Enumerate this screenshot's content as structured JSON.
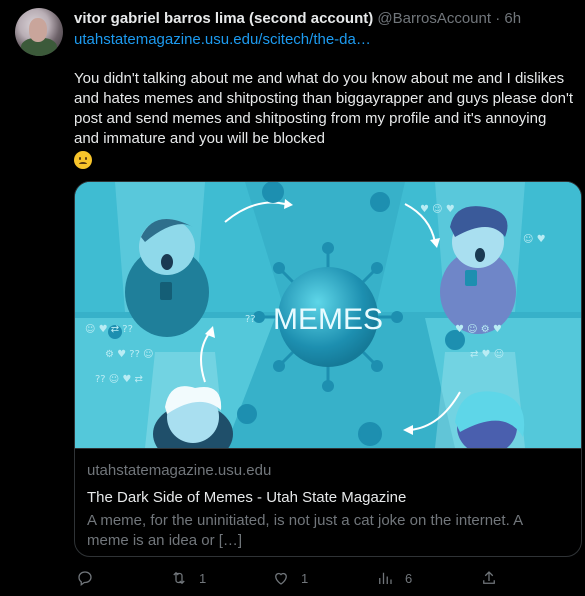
{
  "author": {
    "display_name": "vitor gabriel barros lima (second account)",
    "handle": "@BarrosAccount",
    "separator": "·",
    "time": "6h"
  },
  "tweet": {
    "link_text": "utahstatemagazine.usu.edu/scitech/the-da…",
    "body": "You didn't talking about me and what do you know about me and I dislikes and hates memes and shitposting than biggayrapper and guys please don't post and send memes and shitposting from my profile and it's annoying and immature and you will be blocked",
    "emoji": "frowning-face-emoji"
  },
  "card": {
    "image_text": "MEMES",
    "domain": "utahstatemagazine.usu.edu",
    "title": "The Dark Side of Memes - Utah State Magazine",
    "description": "A meme, for the uninitiated, is not just a cat joke on the internet. A meme is an idea or […]"
  },
  "actions": {
    "reply": {
      "icon": "reply-icon",
      "count": ""
    },
    "retweet": {
      "icon": "retweet-icon",
      "count": "1"
    },
    "like": {
      "icon": "heart-icon",
      "count": "1"
    },
    "views": {
      "icon": "views-icon",
      "count": "6"
    },
    "share": {
      "icon": "share-icon",
      "count": ""
    }
  },
  "colors": {
    "background": "#000000",
    "link": "#1d9bf0",
    "muted": "#71767b",
    "card_teal": "#37b1c9"
  }
}
